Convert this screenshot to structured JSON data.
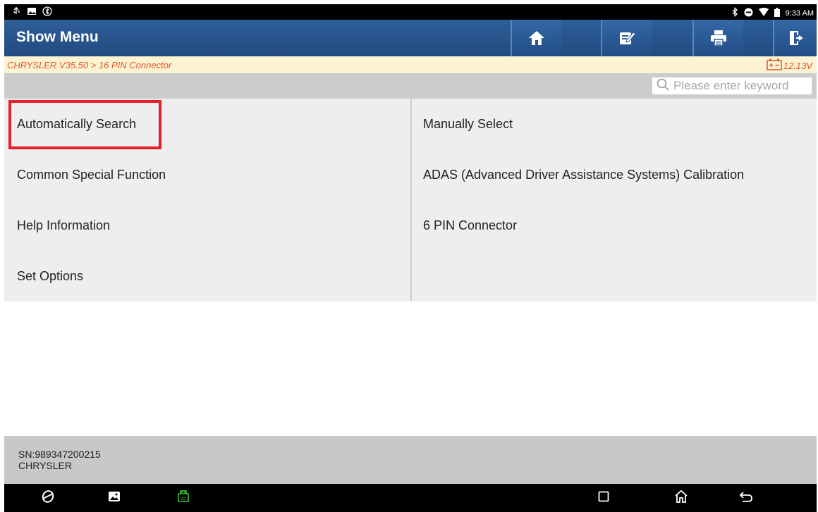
{
  "status_bar": {
    "left_icons": [
      "usb-icon",
      "image-icon",
      "bluetooth-circle-icon"
    ],
    "right_icons": [
      "bluetooth-icon",
      "minus-circle-icon",
      "wifi-icon",
      "battery-icon"
    ],
    "time": "9:33 AM"
  },
  "header": {
    "title": "Show Menu",
    "buttons": [
      "home-icon",
      "edit-icon",
      "print-icon",
      "exit-icon"
    ]
  },
  "breadcrumb": {
    "path": "CHRYSLER V35.50 > 16 PIN Connector",
    "voltage": "12.13V"
  },
  "search": {
    "placeholder": "Please enter keyword"
  },
  "menu": {
    "items": [
      "Automatically Search",
      "Manually Select",
      "Common Special Function",
      "ADAS (Advanced Driver Assistance Systems) Calibration",
      "Help Information",
      "6 PIN Connector",
      "Set Options"
    ],
    "highlighted": "Automatically Search"
  },
  "footer": {
    "sn": "SN:989347200215",
    "brand": "CHRYSLER"
  },
  "colors": {
    "title_bar": "#2a5790",
    "breadcrumb_text": "#e4542a",
    "highlight_border": "#e61e2a",
    "vci_icon": "#3cc43c"
  }
}
